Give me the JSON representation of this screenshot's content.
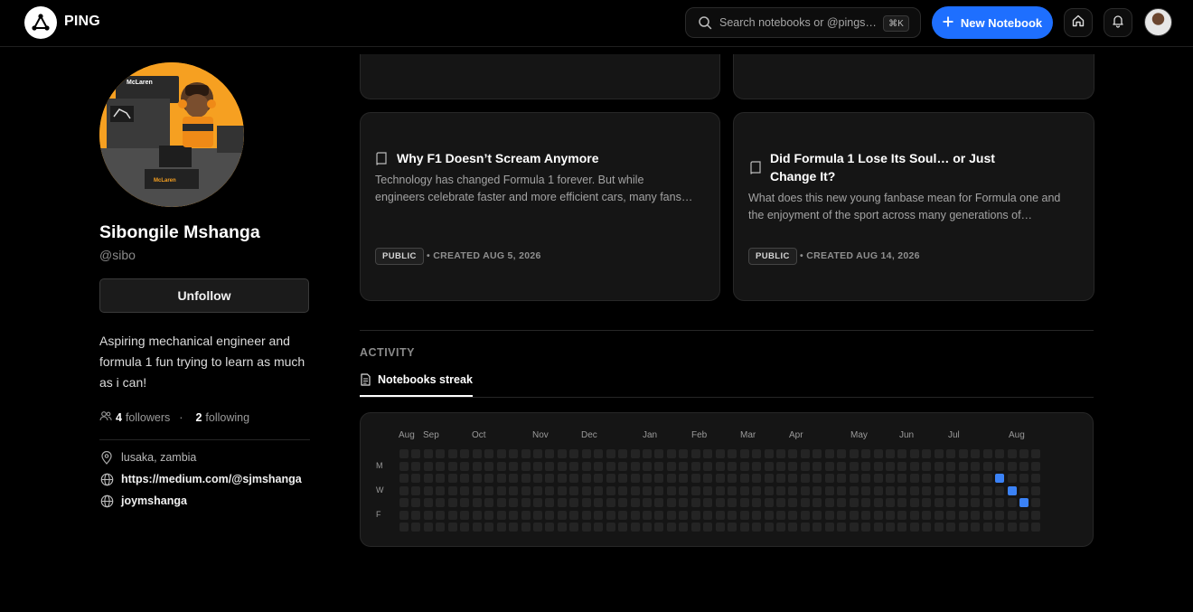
{
  "header": {
    "brand": "PING",
    "search_placeholder": "Search notebooks or @pings…",
    "shortcut": "⌘K",
    "new_notebook": "New Notebook",
    "icons": [
      "logo-icon",
      "search-icon",
      "plus-icon",
      "home-icon",
      "bell-icon"
    ]
  },
  "profile": {
    "name": "Sibongile Mshanga",
    "handle": "@sibo",
    "unfollow": "Unfollow",
    "bio": "Aspiring mechanical engineer and formula 1 fun trying to learn as much as i can!",
    "followers_count": "4",
    "followers_label": "followers",
    "separator": "·",
    "following_count": "2",
    "following_label": "following",
    "location": "lusaka, zambia",
    "website": "https://medium.com/@sjmshanga",
    "social": "joymshanga",
    "avatar_badge_text": "McLaren"
  },
  "notebooks": [
    {
      "title": "Why F1 Doesn’t Scream Anymore",
      "description": "Technology has changed Formula 1 forever. But while engineers celebrate faster and more efficient cars, many fans…",
      "visibility": "PUBLIC",
      "created": "• CREATED AUG 5, 2026"
    },
    {
      "title": "Did Formula 1 Lose Its Soul… or Just Change It?",
      "description": "What does this new young fanbase mean for Formula one and the enjoyment of the sport across many generations of…",
      "visibility": "PUBLIC",
      "created": "• CREATED AUG 14, 2026"
    }
  ],
  "activity": {
    "label": "ACTIVITY",
    "tab": "Notebooks streak",
    "months": [
      "Aug",
      "Sep",
      "Oct",
      "Nov",
      "Dec",
      "Jan",
      "Feb",
      "Mar",
      "Apr",
      "May",
      "Jun",
      "Jul",
      "Aug"
    ],
    "day_labels": [
      "M",
      "W",
      "F"
    ],
    "weeks": 53,
    "active_days": [
      {
        "week": 49,
        "day": 2
      },
      {
        "week": 50,
        "day": 3
      },
      {
        "week": 51,
        "day": 4
      }
    ],
    "colors": {
      "empty": "#242424",
      "active": "#3b82f6"
    }
  }
}
